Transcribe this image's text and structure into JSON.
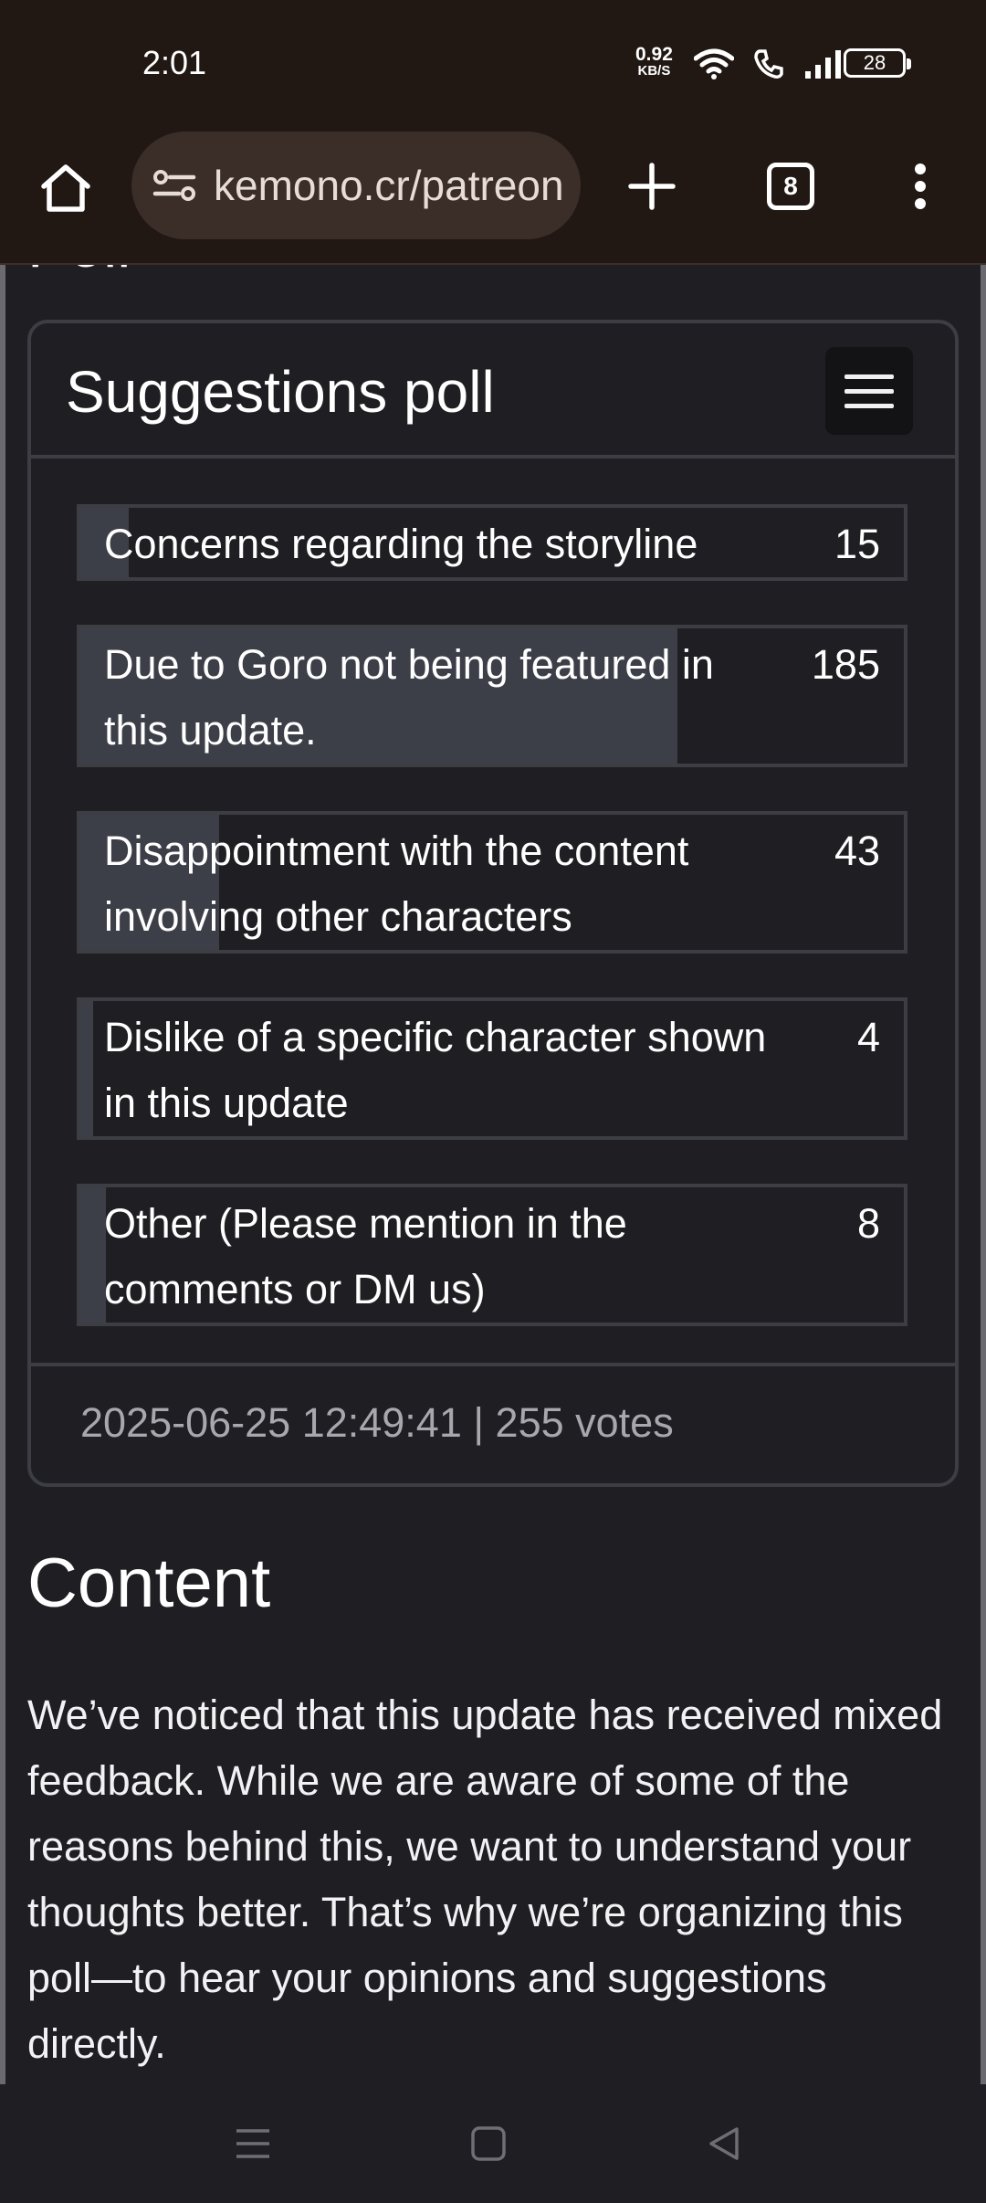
{
  "status_bar": {
    "time": "2:01",
    "net_speed_value": "0.92",
    "net_speed_unit": "KB/S",
    "battery": "28"
  },
  "browser": {
    "url": "kemono.cr/patreon",
    "tab_count": "8"
  },
  "section_heading": "Poll",
  "poll": {
    "title": "Suggestions poll",
    "options": [
      {
        "label": "Concerns regarding the storyline",
        "votes": "15",
        "fraction": 0.059
      },
      {
        "label": "Due to Goro not being featured in this update.",
        "votes": "185",
        "fraction": 0.725
      },
      {
        "label": "Disappointment with the content involving other characters",
        "votes": "43",
        "fraction": 0.169
      },
      {
        "label": "Dislike of a specific character shown in this update",
        "votes": "4",
        "fraction": 0.016
      },
      {
        "label": "Other (Please mention in the comments or DM us)",
        "votes": "8",
        "fraction": 0.031
      }
    ],
    "meta": "2025-06-25 12:49:41 | 255 votes"
  },
  "content": {
    "heading": "Content",
    "body": "We’ve noticed that this update has received mixed feedback. While we are aware of some of the reasons behind this, we want to understand your thoughts better. That’s why we’re organizing this poll—to hear your opinions and suggestions directly."
  },
  "colors": {
    "bar_background": "#211713",
    "url_pill": "#3b2e29",
    "page_background": "#1e1e23",
    "vote_fill": "#3d3f48",
    "border": "#3d3e44"
  }
}
